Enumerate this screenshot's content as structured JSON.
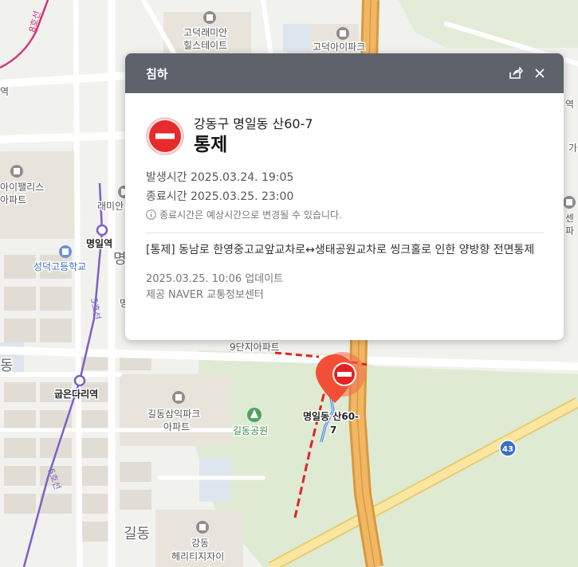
{
  "popup": {
    "title": "침하",
    "location": "강동구 명일동 산60-7",
    "type": "통제",
    "start_time": "발생시간 2025.03.24. 19:05",
    "end_time": "종료시간 2025.03.25. 23:00",
    "notice": "종료시간은 예상시간으로 변경될 수 있습니다.",
    "description": "[통제] 동남로 한영중고교앞교차로↔생태공원교차로 씽크홀로 인한 양방향 전면통제",
    "updated": "2025.03.25. 10:06 업데이트",
    "provider": "제공 NAVER 교통정보센터",
    "share_icon": "share-icon",
    "close_icon": "close-icon"
  },
  "map": {
    "labels": {
      "line8": "8호선",
      "line5_a": "5호선",
      "line5_b": "5호선",
      "godeok_raemian_1": "고덕래미안",
      "godeok_raemian_2": "힐스테이트",
      "godeok_ipark": "고덕아이파크",
      "station_left_top": "역",
      "ipalace_1": "아이팰리스",
      "ipalace_2": "아파트",
      "raemi": "래미안",
      "myeongil_station": "명일역",
      "seongdeok_school": "성덕고등학교",
      "dong_left": "동",
      "myeong_a": "명",
      "myeong_b": "명",
      "godeun_station": "굽은다리역",
      "danji9": "9단지아파트",
      "gildong_samik_1": "길동삼익파크",
      "gildong_samik_2": "아파트",
      "gildong_park": "길동공원",
      "marker_label_1": "명일동 산60-",
      "marker_label_2": "7",
      "gildong": "길동",
      "gildong_heritage_1": "강동",
      "gildong_heritage_2": "헤리티지자이",
      "right_sen": "센",
      "right_par": "파",
      "right_yeok": "역",
      "right_ga": "가",
      "route_43": "43"
    }
  }
}
